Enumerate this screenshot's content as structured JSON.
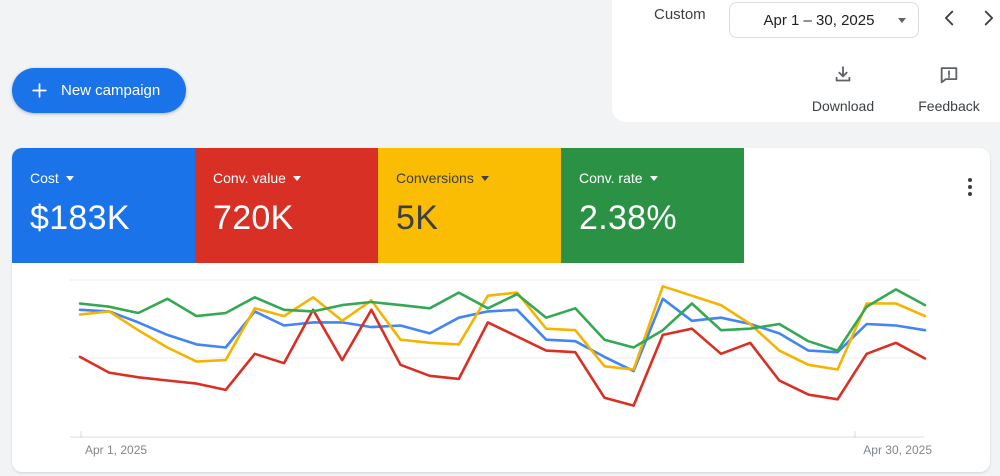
{
  "header": {
    "preset_label": "Custom",
    "date_range": "Apr 1 – 30, 2025",
    "download_label": "Download",
    "feedback_label": "Feedback"
  },
  "actions": {
    "new_campaign_label": "New campaign"
  },
  "scorecards": [
    {
      "label": "Cost",
      "value": "$183K",
      "color": "#1a73e8",
      "text_color": "#ffffff"
    },
    {
      "label": "Conv. value",
      "value": "720K",
      "color": "#d93025",
      "text_color": "#ffffff"
    },
    {
      "label": "Conversions",
      "value": "5K",
      "color": "#fbbc04",
      "text_color": "#3c4043"
    },
    {
      "label": "Conv. rate",
      "value": "2.38%",
      "color": "#2b9245",
      "text_color": "#ffffff"
    }
  ],
  "chart_data": {
    "type": "line",
    "title": "Campaign performance, Apr 1 – 30, 2025 (daily)",
    "x_axis": {
      "start_label": "Apr 1, 2025",
      "end_label": "Apr 30, 2025",
      "points": 30,
      "unit": "day"
    },
    "y_axis": {
      "labels_visible": false,
      "scale": "relative index 0–110, light gridlines at 50 and 100"
    },
    "grid": true,
    "legend": false,
    "series": [
      {
        "id": "cost",
        "name": "Cost",
        "color": "#4285f4",
        "values": [
          81,
          80,
          73,
          65,
          59,
          57,
          80,
          71,
          73,
          73,
          70,
          71,
          66,
          76,
          80,
          81,
          62,
          61,
          51,
          42,
          88,
          74,
          76,
          72,
          66,
          55,
          54,
          72,
          71,
          68
        ]
      },
      {
        "id": "conv-value",
        "name": "Conv. value",
        "color": "#d93025",
        "values": [
          51,
          41,
          38,
          36,
          34,
          30,
          53,
          47,
          81,
          49,
          81,
          46,
          39,
          37,
          73,
          64,
          55,
          54,
          25,
          20,
          65,
          69,
          53,
          60,
          36,
          27,
          24,
          53,
          60,
          50
        ]
      },
      {
        "id": "conversions",
        "name": "Conversions",
        "color": "#f4b400",
        "values": [
          78,
          80,
          68,
          57,
          48,
          49,
          82,
          77,
          89,
          74,
          87,
          62,
          60,
          59,
          90,
          92,
          69,
          68,
          45,
          43,
          96,
          90,
          84,
          72,
          55,
          46,
          43,
          85,
          85,
          77
        ]
      },
      {
        "id": "conv-rate",
        "name": "Conv. rate",
        "color": "#34a853",
        "values": [
          85,
          83,
          79,
          88,
          77,
          79,
          89,
          81,
          80,
          84,
          86,
          84,
          82,
          92,
          82,
          91,
          76,
          82,
          62,
          57,
          68,
          85,
          68,
          69,
          72,
          61,
          55,
          83,
          94,
          84
        ]
      }
    ]
  }
}
